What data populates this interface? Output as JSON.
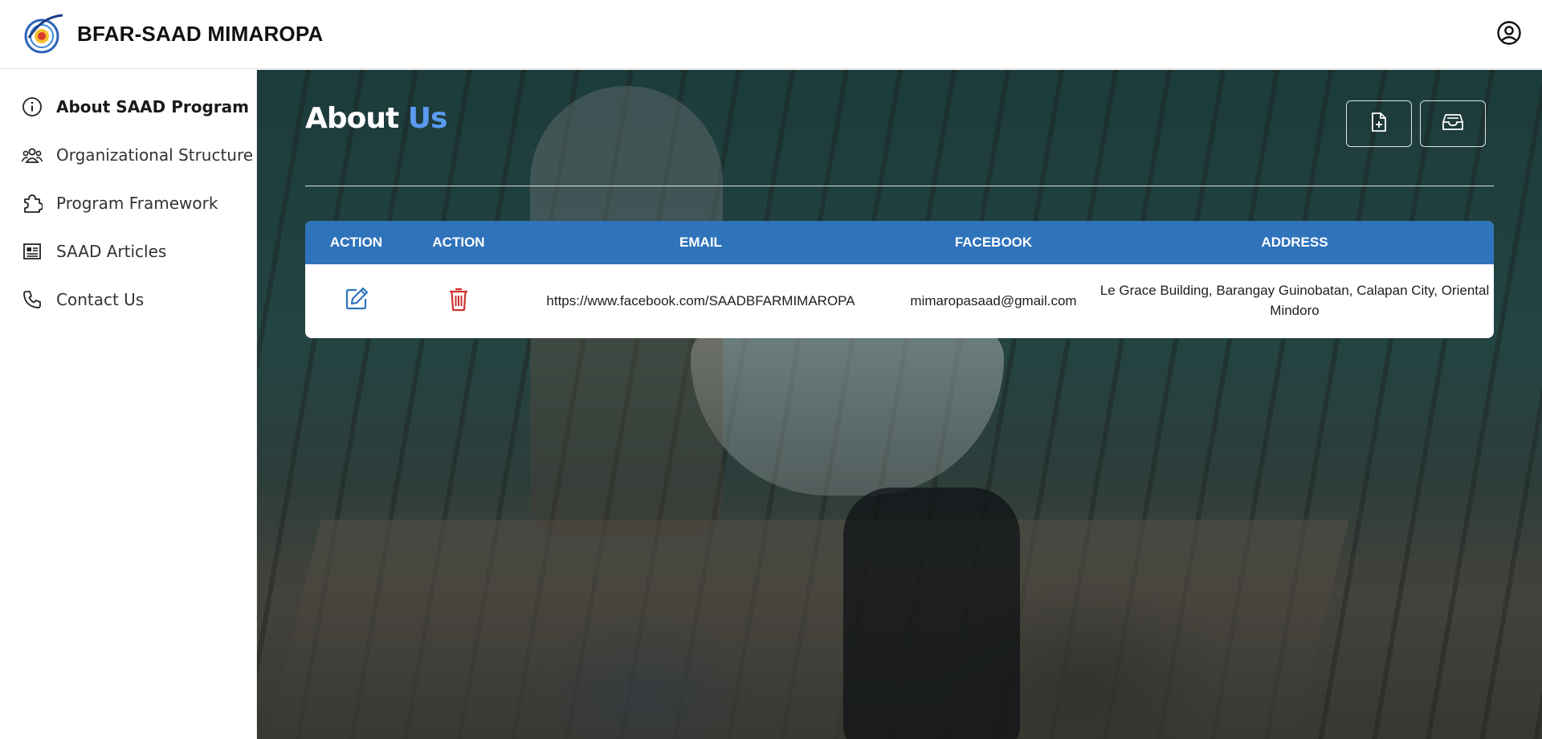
{
  "app": {
    "brand": "BFAR-SAAD MIMAROPA",
    "logo_icon": "bfar-logo-icon",
    "profile_icon": "user-circle-icon"
  },
  "sidebar": {
    "items": [
      {
        "label": "About SAAD Program",
        "icon": "info-icon",
        "active": true
      },
      {
        "label": "Organizational Structure",
        "icon": "users-group-icon",
        "active": false
      },
      {
        "label": "Program Framework",
        "icon": "puzzle-icon",
        "active": false
      },
      {
        "label": "SAAD Articles",
        "icon": "newspaper-icon",
        "active": false
      },
      {
        "label": "Contact Us",
        "icon": "phone-icon",
        "active": false
      }
    ]
  },
  "main": {
    "title_primary": "About",
    "title_accent": "Us",
    "toolbar": {
      "add_icon": "file-plus-icon",
      "archive_icon": "archive-icon"
    },
    "table": {
      "headers": [
        "ACTION",
        "ACTION",
        "EMAIL",
        "FACEBOOK",
        "ADDRESS"
      ],
      "rows": [
        {
          "edit_icon": "edit-icon",
          "delete_icon": "trash-icon",
          "email": "https://www.facebook.com/SAADBFARMIMAROPA",
          "facebook": "mimaropasaad@gmail.com",
          "address": "Le Grace Building, Barangay Guinobatan, Calapan City, Oriental Mindoro"
        }
      ]
    }
  },
  "colors": {
    "header_blue": "#2f73bb",
    "accent_blue": "#5a9bf0",
    "edit_blue": "#2f73bb",
    "delete_red": "#d0312d"
  }
}
